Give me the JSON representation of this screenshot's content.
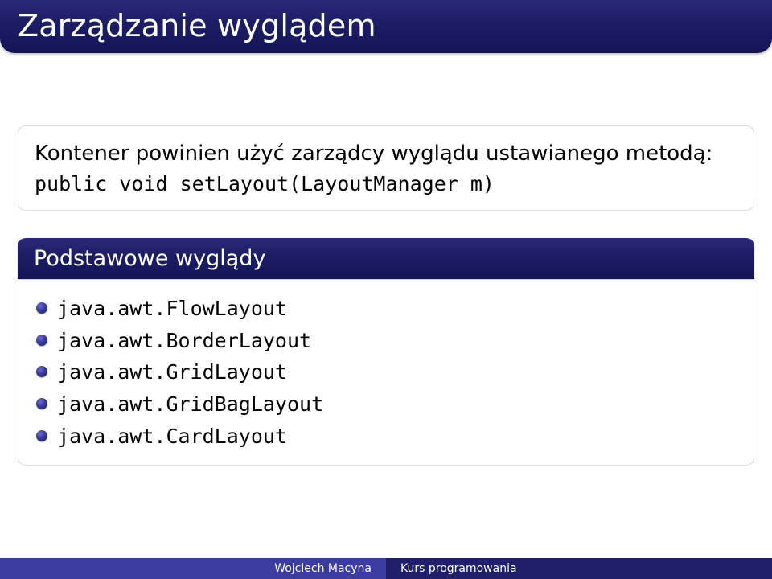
{
  "title": "Zarządzanie wyglądem",
  "intro": {
    "line1": "Kontener powinien użyć zarządcy wyglądu ustawianego metodą:",
    "code": "public void setLayout(LayoutManager m)"
  },
  "block2": {
    "header": "Podstawowe wyglądy",
    "items": [
      "java.awt.FlowLayout",
      "java.awt.BorderLayout",
      "java.awt.GridLayout",
      "java.awt.GridBagLayout",
      "java.awt.CardLayout"
    ]
  },
  "footer": {
    "author": "Wojciech Macyna",
    "course": "Kurs programowania"
  }
}
